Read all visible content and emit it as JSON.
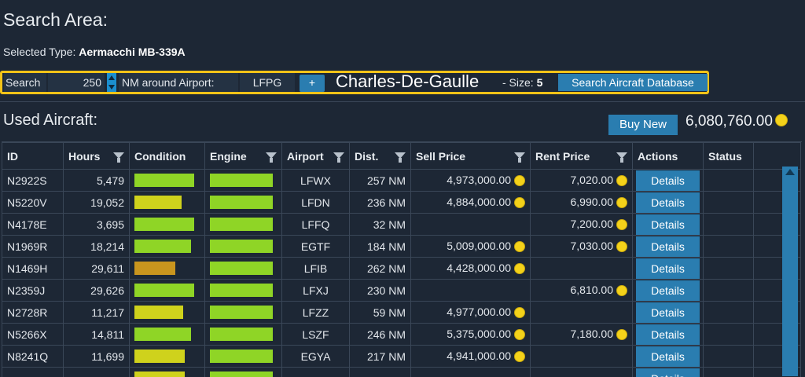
{
  "page": {
    "title": "Search Area:",
    "selected_type_label": "Selected Type:",
    "selected_type_value": "Aermacchi MB-339A"
  },
  "search": {
    "label": "Search",
    "radius": "250",
    "nm_label": "NM around Airport:",
    "airport_code": "LFPG",
    "add_label": "+",
    "airport_name": "Charles-De-Gaulle",
    "size_label": "- Size:",
    "size_value": "5",
    "search_button": "Search Aircraft Database"
  },
  "used": {
    "title": "Used Aircraft:",
    "buy_new": "Buy New",
    "balance": "6,080,760.00"
  },
  "table": {
    "columns": [
      "ID",
      "Hours",
      "Condition",
      "Engine",
      "Airport",
      "Dist.",
      "Sell Price",
      "Rent Price",
      "Actions",
      "Status"
    ],
    "details_label": "Details",
    "rows": [
      {
        "id": "N2922S",
        "hours": "5,479",
        "condition": 0.95,
        "condition_color": "#8fd526",
        "engine": 0.98,
        "engine_color": "#8fd526",
        "airport": "LFWX",
        "dist": "257 NM",
        "sell": "4,973,000.00",
        "rent": "7,020.00"
      },
      {
        "id": "N5220V",
        "hours": "19,052",
        "condition": 0.75,
        "condition_color": "#cfd21c",
        "engine": 0.98,
        "engine_color": "#8fd526",
        "airport": "LFDN",
        "dist": "236 NM",
        "sell": "4,884,000.00",
        "rent": "6,990.00"
      },
      {
        "id": "N4178E",
        "hours": "3,695",
        "condition": 0.95,
        "condition_color": "#8fd526",
        "engine": 0.98,
        "engine_color": "#8fd526",
        "airport": "LFFQ",
        "dist": "32 NM",
        "sell": "",
        "rent": "7,200.00"
      },
      {
        "id": "N1969R",
        "hours": "18,214",
        "condition": 0.9,
        "condition_color": "#8fd526",
        "engine": 0.98,
        "engine_color": "#8fd526",
        "airport": "EGTF",
        "dist": "184 NM",
        "sell": "5,009,000.00",
        "rent": "7,030.00"
      },
      {
        "id": "N1469H",
        "hours": "29,611",
        "condition": 0.65,
        "condition_color": "#c9951e",
        "engine": 0.98,
        "engine_color": "#8fd526",
        "airport": "LFIB",
        "dist": "262 NM",
        "sell": "4,428,000.00",
        "rent": ""
      },
      {
        "id": "N2359J",
        "hours": "29,626",
        "condition": 0.95,
        "condition_color": "#8fd526",
        "engine": 0.98,
        "engine_color": "#8fd526",
        "airport": "LFXJ",
        "dist": "230 NM",
        "sell": "",
        "rent": "6,810.00"
      },
      {
        "id": "N2728R",
        "hours": "11,217",
        "condition": 0.78,
        "condition_color": "#cfd21c",
        "engine": 0.98,
        "engine_color": "#8fd526",
        "airport": "LFZZ",
        "dist": "59 NM",
        "sell": "4,977,000.00",
        "rent": ""
      },
      {
        "id": "N5266X",
        "hours": "14,811",
        "condition": 0.9,
        "condition_color": "#8fd526",
        "engine": 0.98,
        "engine_color": "#8fd526",
        "airport": "LSZF",
        "dist": "246 NM",
        "sell": "5,375,000.00",
        "rent": "7,180.00"
      },
      {
        "id": "N8241Q",
        "hours": "11,699",
        "condition": 0.8,
        "condition_color": "#cfd21c",
        "engine": 0.98,
        "engine_color": "#8fd526",
        "airport": "EGYA",
        "dist": "217 NM",
        "sell": "4,941,000.00",
        "rent": ""
      },
      {
        "id": "",
        "hours": "",
        "condition": 0.8,
        "condition_color": "#cfd21c",
        "engine": 0.98,
        "engine_color": "#8fd526",
        "airport": "",
        "dist": "",
        "sell": "",
        "rent": ""
      }
    ]
  },
  "colors": {
    "accent": "#2a7db0",
    "highlight_border": "#f2c318",
    "coin": "#f4d21a",
    "background": "#1d2735"
  },
  "icons": {
    "filter": "filter-funnel-icon",
    "coin": "coin-icon",
    "spinner": "spinner-arrows-icon",
    "scroll_up": "scroll-up-arrow-icon"
  }
}
